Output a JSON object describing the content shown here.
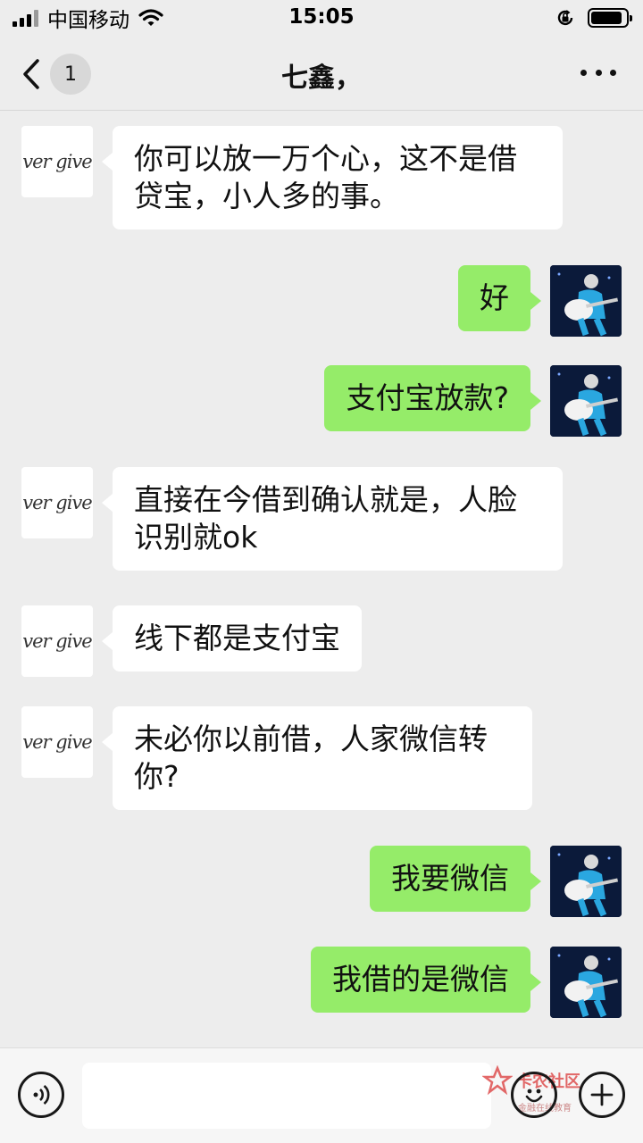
{
  "status_bar": {
    "carrier": "中国移动",
    "time": "15:05"
  },
  "nav": {
    "back_badge": "1",
    "title": "七鑫，"
  },
  "avatars": {
    "contact_text": "ver give"
  },
  "messages": [
    {
      "side": "left",
      "text": "你可以放一万个心，这不是借贷宝，小人多的事。"
    },
    {
      "side": "right",
      "text": "好"
    },
    {
      "side": "right",
      "text": "支付宝放款?"
    },
    {
      "side": "left",
      "text": "直接在今借到确认就是，人脸识别就ok"
    },
    {
      "side": "left",
      "text": "线下都是支付宝"
    },
    {
      "side": "left",
      "text": "未必你以前借，人家微信转你?"
    },
    {
      "side": "right",
      "text": "我要微信"
    },
    {
      "side": "right",
      "text": "我借的是微信"
    }
  ],
  "watermark": {
    "name": "卡农社区",
    "sub": "金融在线教育"
  },
  "colors": {
    "background": "#ededed",
    "bubble_sent": "#95ec69",
    "bubble_received": "#ffffff"
  },
  "icons": [
    "signal-icon",
    "wifi-icon",
    "orientation-lock-icon",
    "battery-icon",
    "back-chevron-icon",
    "more-icon",
    "voice-icon",
    "emoji-icon",
    "plus-icon"
  ]
}
